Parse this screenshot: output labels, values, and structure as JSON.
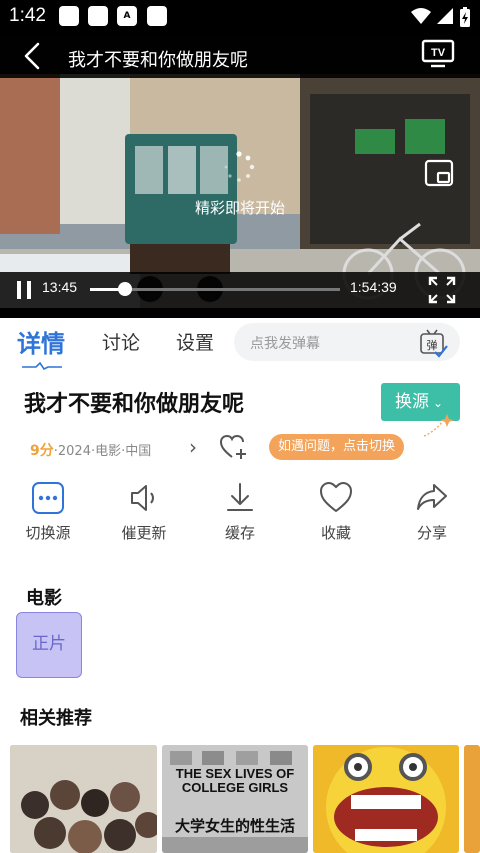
{
  "status_bar": {
    "time": "1:42",
    "notif_a_letter": "A"
  },
  "player": {
    "title": "我才不要和你做朋友呢",
    "loading_text": "精彩即将开始",
    "current_time": "13:45",
    "total_time": "1:54:39",
    "progress": 0.14,
    "tv_label": "TV"
  },
  "tabs": [
    {
      "label": "详情",
      "active": true
    },
    {
      "label": "讨论",
      "active": false
    },
    {
      "label": "设置",
      "active": false
    }
  ],
  "danmaku": {
    "placeholder": "点我发弹幕",
    "icon_label": "弹"
  },
  "info": {
    "title": "我才不要和你做朋友呢",
    "switch_source_label": "换源",
    "score": "9分",
    "meta": "·2024·电影·中国",
    "tip": "如遇问题，点击切换"
  },
  "actions": [
    {
      "label": "切换源",
      "icon": "more-dots-icon"
    },
    {
      "label": "催更新",
      "icon": "speaker-icon"
    },
    {
      "label": "缓存",
      "icon": "download-icon"
    },
    {
      "label": "收藏",
      "icon": "heart-icon"
    },
    {
      "label": "分享",
      "icon": "share-icon"
    }
  ],
  "sections": {
    "episodes_title": "电影",
    "episode_label": "正片",
    "recommend_title": "相关推荐"
  },
  "posters": [
    {
      "title": "",
      "caption": ""
    },
    {
      "title": "THE SEX LIVES OF COLLEGE GIRLS",
      "caption": "大学女生的性生活"
    },
    {
      "title": "",
      "caption": ""
    }
  ],
  "colors": {
    "accent": "#2f74d8",
    "switch": "#3dbea6",
    "score": "#f0a23a",
    "tip": "#f4a45a",
    "episode_bg": "#c7c4f5"
  }
}
